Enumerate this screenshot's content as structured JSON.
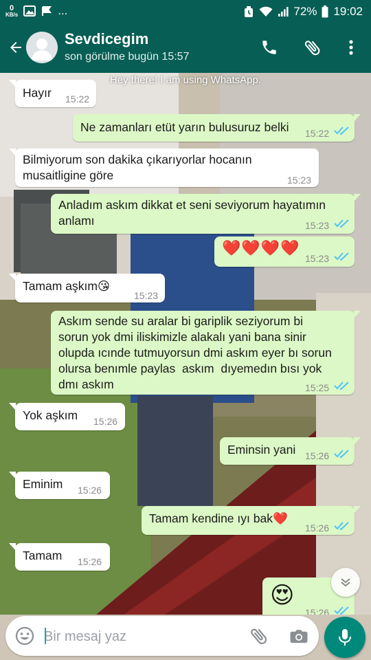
{
  "status_bar": {
    "speed_value": "0",
    "speed_unit": "KB/s",
    "more_indicator": "...",
    "battery": "72%",
    "time": "19:02"
  },
  "header": {
    "contact_name": "Sevdicegim",
    "last_seen": "son görülme bugün 15:57"
  },
  "chat": {
    "status_note": "Hey there! I am using WhatsApp.",
    "messages": [
      {
        "text": "Hayır",
        "time": "15:22"
      },
      {
        "text": "Ne zamanları etüt yarın bulusuruz belki",
        "time": "15:22"
      },
      {
        "text": "Bilmiyorum son dakika çıkarıyorlar hocanın\nmusaitligine göre",
        "time": "15:23"
      },
      {
        "text": "Anladım askım dikkat et seni seviyorum hayatımın\nanlamı",
        "time": "15:23"
      },
      {
        "text": "❤️❤️❤️❤️",
        "time": "15:23"
      },
      {
        "text": "Tamam aşkım😘",
        "time": "15:23"
      },
      {
        "text": "Askım sende su aralar bi gariplik seziyorum bi\nsorun yok dmi iliskimizle alakalı yani bana sinir\nolupda ıcınde tutmuyorsun dmi askım eyer bı sorun\nolursa benımle paylas  askım  dıyemedın bısı yok\ndmı askım",
        "time": "15:25"
      },
      {
        "text": "Yok aşkım",
        "time": "15:26"
      },
      {
        "text": "Eminsin yani",
        "time": "15:26"
      },
      {
        "text": "Eminim",
        "time": "15:26"
      },
      {
        "text": "Tamam kendine ıyı bak❤️",
        "time": "15:26"
      },
      {
        "text": "Tamam",
        "time": "15:26"
      },
      {
        "text": "😍",
        "time": "15:26"
      }
    ]
  },
  "input": {
    "placeholder": "Bir mesaj yaz"
  },
  "colors": {
    "header": "#075e54",
    "outgoing_bubble": "#dcf8c6",
    "incoming_bubble": "#ffffff",
    "read_ticks": "#4fc3f7",
    "mic_button": "#00897b"
  },
  "icons": [
    "back-arrow-icon",
    "call-icon",
    "attachment-icon",
    "more-vert-icon",
    "emoji-icon",
    "camera-icon",
    "mic-icon",
    "chevron-down-icon",
    "read-receipt-icon"
  ]
}
